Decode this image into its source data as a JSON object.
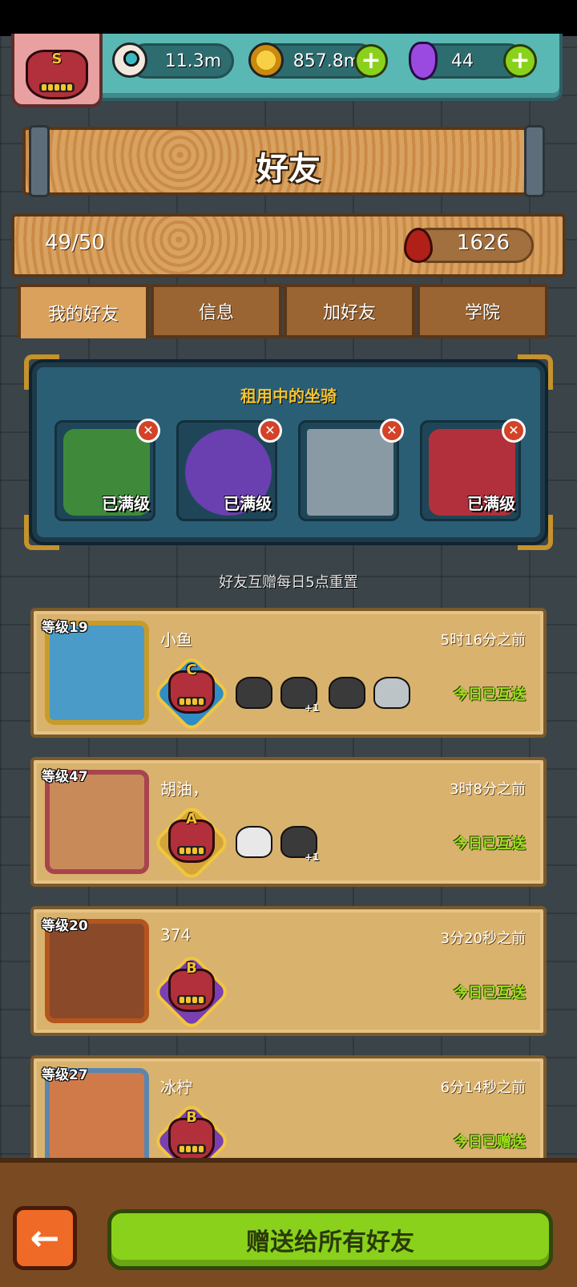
{
  "resources": {
    "eye": "11.3m",
    "coins": "857.8m",
    "potion": "44"
  },
  "player_grade": "S",
  "title": "好友",
  "friend_count": "49/50",
  "blood": "1626",
  "tabs": [
    {
      "label": "我的好友",
      "active": true
    },
    {
      "label": "信息",
      "active": false
    },
    {
      "label": "加好友",
      "active": false
    },
    {
      "label": "学院",
      "active": false
    }
  ],
  "renting": {
    "title": "租用中的坐骑",
    "mounts": [
      {
        "name": "dragon-mount",
        "max_label": "已满级",
        "color": "#3e8a3a"
      },
      {
        "name": "rose-mount",
        "max_label": "已满级",
        "color": "#6a3fb0"
      },
      {
        "name": "machine-mount",
        "max_label": "",
        "color": "#8a9aa4"
      },
      {
        "name": "demon-mount",
        "max_label": "已满级",
        "color": "#b2303b"
      }
    ]
  },
  "reset_note": "好友互赠每日5点重置",
  "friends": [
    {
      "level": "等级19",
      "name": "小鱼",
      "time": "5时16分之前",
      "status": "今日已互送",
      "grade": "C",
      "grade_color": "#2f8dc4",
      "avatar_color": "#4a9bc8",
      "frame_color": "#c79b2a",
      "mounts": 4,
      "plus": "+1"
    },
    {
      "level": "等级47",
      "name": "胡油，",
      "time": "3时8分之前",
      "status": "今日已互送",
      "grade": "A",
      "grade_color": "#d4a33a",
      "avatar_color": "#c98a5a",
      "frame_color": "#a8444e",
      "mounts": 2,
      "plus": "+1"
    },
    {
      "level": "等级20",
      "name": "374",
      "time": "3分20秒之前",
      "status": "今日已互送",
      "grade": "B",
      "grade_color": "#7a3fb0",
      "avatar_color": "#8a4a2a",
      "frame_color": "#b4551e",
      "mounts": 0,
      "plus": ""
    },
    {
      "level": "等级27",
      "name": "冰柠",
      "time": "6分14秒之前",
      "status": "今日已赠送",
      "grade": "B",
      "grade_color": "#7a3fb0",
      "avatar_color": "#d07a4a",
      "frame_color": "#5a86b0",
      "mounts": 0,
      "plus": ""
    }
  ],
  "send_all_label": "赠送给所有好友",
  "back_arrow": "←"
}
